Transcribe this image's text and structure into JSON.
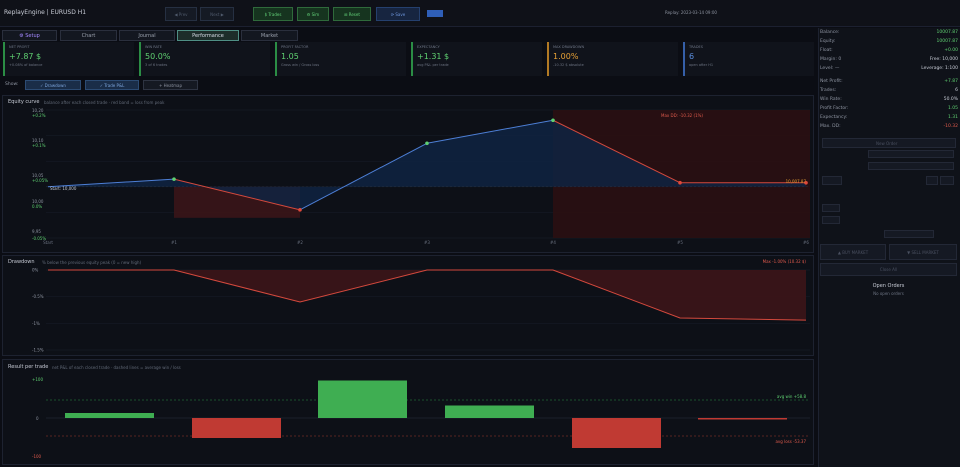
{
  "app": {
    "brand": "ReplayEngine | EURUSD H1",
    "time": "Replay: 2023-03-14 09:00",
    "buttons": [
      "◀ Prev",
      "Next ▶",
      "$ Trades",
      "⚙ Sim",
      "⊞ Reset",
      "⟳ Save"
    ]
  },
  "tabs": [
    "⚙ Setup",
    "Chart",
    "Journal",
    "Performance",
    "Market"
  ],
  "cards": [
    {
      "title": "Net Profit",
      "value": "+7.87 $",
      "sub": "+0.08% of balance",
      "color": "#5fd071",
      "border": "#2b8d45"
    },
    {
      "title": "Win Rate",
      "value": "50.0%",
      "sub": "3 of 6 trades",
      "color": "#5fd071",
      "border": "#2b8d45"
    },
    {
      "title": "Profit Factor",
      "value": "1.05",
      "sub": "Gross win / Gross loss",
      "color": "#5fd071",
      "border": "#2b8d45"
    },
    {
      "title": "Expectancy",
      "value": "+1.31 $",
      "sub": "avg P&L per trade",
      "color": "#5fd071",
      "border": "#2b8d45"
    },
    {
      "title": "Max Drawdown",
      "value": "1.00%",
      "sub": "-10.32 $ absolute",
      "color": "#e8a135",
      "border": "#b27a24"
    },
    {
      "title": "Trades",
      "value": "6",
      "sub": "open after H1",
      "color": "#5b8fe0",
      "border": "#355fa8"
    }
  ],
  "show": {
    "label": "Show:",
    "toggles": [
      "✓ Drawdown",
      "✓ Trade P&L",
      "+ Heatmap"
    ]
  },
  "equity": {
    "title": "Equity curve",
    "subtitle": "balance after each closed trade · red band = loss from peak",
    "start_label": "Start: 10,000",
    "end_label": "10,007.87",
    "maxdd_label": "Max DD: -10.32 (1%)",
    "y_ticks": [
      "10,20",
      "+0.2%",
      "10,10",
      "+0.1%",
      "10,05",
      "+0.05%",
      "10,00",
      "0.0%",
      "9,95",
      "-0.05%",
      "9,90",
      "-0.1%"
    ],
    "x_ticks": [
      "Start",
      "#1",
      "#2",
      "#3",
      "#4",
      "#5",
      "#6"
    ]
  },
  "drawdown": {
    "title": "Drawdown",
    "subtitle": "% below the previous equity peak (0 = new high)",
    "max_label": "Max -1.00% (10.32 $)",
    "y_ticks": [
      "0%",
      "-0.5%",
      "-1%",
      "-1.5%"
    ]
  },
  "pnl": {
    "title": "Result per trade",
    "subtitle": "net P&L of each closed trade · dashed lines = average win / loss",
    "avg_win_label": "avg win +58.8",
    "avg_loss_label": "avg loss -53.37",
    "y_ticks": [
      "+100",
      "0",
      "-100"
    ]
  },
  "chart_data": [
    {
      "type": "line",
      "title": "Equity curve",
      "x": [
        "Start",
        "#1",
        "#2",
        "#3",
        "#4",
        "#5",
        "#6"
      ],
      "series": [
        {
          "values": [
            10000,
            10015,
            9955,
            10085,
            10130,
            10008,
            10007.87
          ]
        }
      ],
      "ylim": [
        9900,
        10150
      ]
    },
    {
      "type": "area",
      "title": "Drawdown",
      "x": [
        "Start",
        "#1",
        "#2",
        "#3",
        "#4",
        "#5",
        "#6"
      ],
      "series": [
        {
          "values": [
            0,
            0,
            -0.6,
            0,
            0,
            -0.9,
            -0.94
          ]
        }
      ],
      "ylim": [
        -1.5,
        0
      ]
    },
    {
      "type": "bar",
      "title": "Result per trade",
      "categories": [
        "#1",
        "#2",
        "#3",
        "#4",
        "#5",
        "#6"
      ],
      "values": [
        10,
        -40,
        75,
        25,
        -60,
        -3
      ],
      "ylim": [
        -100,
        100
      ]
    }
  ],
  "account": {
    "rows": [
      {
        "label": "Balance:",
        "value": "10007.87"
      },
      {
        "label": "Equity:",
        "value": "10007.87"
      },
      {
        "label": "Float:",
        "value": "+0.00"
      },
      {
        "label": "Margin: 0",
        "value": "Free: 10,000"
      },
      {
        "label": "Level: —",
        "value": "Leverage: 1:100"
      }
    ],
    "stats": [
      {
        "label": "Net Profit:",
        "value": "+7.87"
      },
      {
        "label": "Trades:",
        "value": "6"
      },
      {
        "label": "Win Rate:",
        "value": "50.0%"
      },
      {
        "label": "Profit Factor:",
        "value": "1.05"
      },
      {
        "label": "Expectancy:",
        "value": "1.31"
      },
      {
        "label": "Max. DD:",
        "value": "-10.32"
      }
    ]
  },
  "order": {
    "title": "New Order",
    "buy": "▲ BUY MARKET",
    "sell": "▼ SELL MARKET",
    "close": "Close All",
    "open_title": "Open Orders",
    "open_empty": "No open orders"
  }
}
